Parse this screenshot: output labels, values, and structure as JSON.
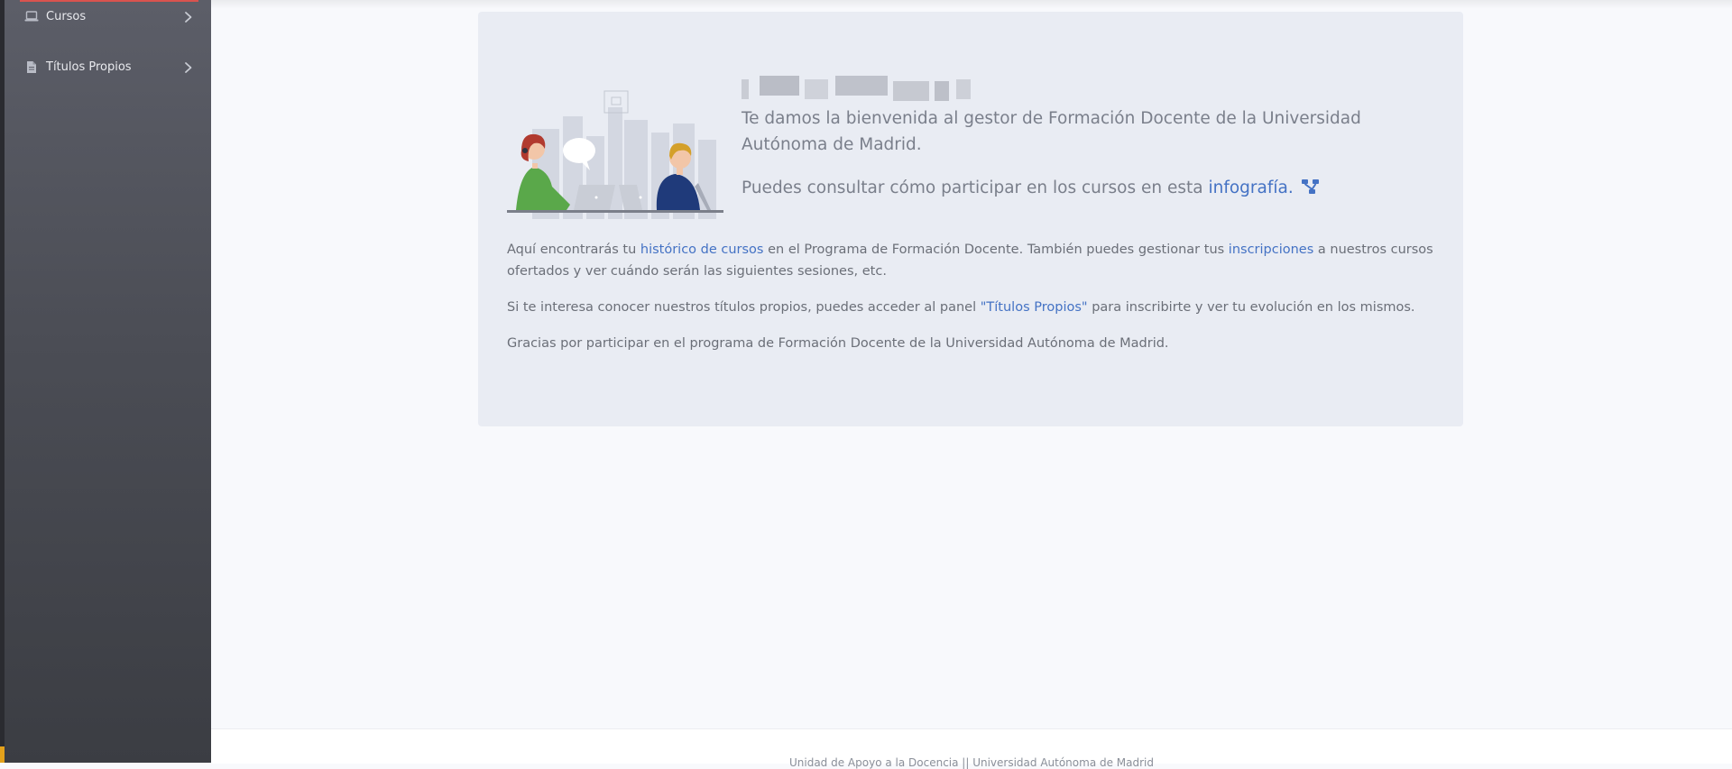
{
  "sidebar": {
    "items": [
      {
        "label": "Cursos",
        "icon": "laptop-icon"
      },
      {
        "label": "Títulos Propios",
        "icon": "document-icon"
      }
    ]
  },
  "welcome": {
    "lead_text": "Te damos la bienvenida al gestor de Formación Docente de la Universidad Autónoma de Madrid.",
    "infographic_prefix": "Puedes consultar cómo participar en los cursos en esta",
    "infographic_link": "infografía.",
    "p1_a": "Aquí encontrarás tu",
    "p1_link1": "histórico de cursos",
    "p1_b": "en el Programa de Formación Docente. También puedes gestionar tus",
    "p1_link2": "inscripciones",
    "p1_c": "a nuestros cursos ofertados y ver cuándo serán las siguientes sesiones, etc.",
    "p2_a": "Si te interesa conocer nuestros títulos propios, puedes acceder al panel",
    "p2_link": "\"Títulos Propios\"",
    "p2_b": "para inscribirte y ver tu evolución en los mismos.",
    "p3": "Gracias por participar en el programa de Formación Docente de la Universidad Autónoma de Madrid."
  },
  "footer": {
    "text": "Unidad de Apoyo a la Docencia || Universidad Autónoma de Madrid"
  },
  "colors": {
    "sidebar_top": "#5c5e68",
    "sidebar_bottom": "#3b3d43",
    "card_bg": "#e9ecf3",
    "link": "#4472c4",
    "accent_orange": "#e3a11b",
    "active_red": "#d9534f"
  }
}
